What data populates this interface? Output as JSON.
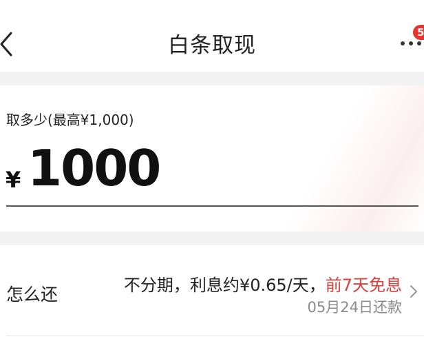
{
  "nav": {
    "back_icon": "back-chevron-icon",
    "title": "白条取现",
    "more_icon": "more-dots-icon",
    "badge_count": "5"
  },
  "amount": {
    "label": "取多少(最高¥1,000)",
    "currency": "¥",
    "value": "1000"
  },
  "repay": {
    "label": "怎么还",
    "plan_text": "不分期，利息约¥0.65/天，",
    "free_text": "前7天免息",
    "date_text": "05月24日还款",
    "chevron_icon": "chevron-right-icon"
  },
  "colors": {
    "accent_red": "#d9403a",
    "badge_red": "#e8332e",
    "background": "#f2f2f2"
  }
}
